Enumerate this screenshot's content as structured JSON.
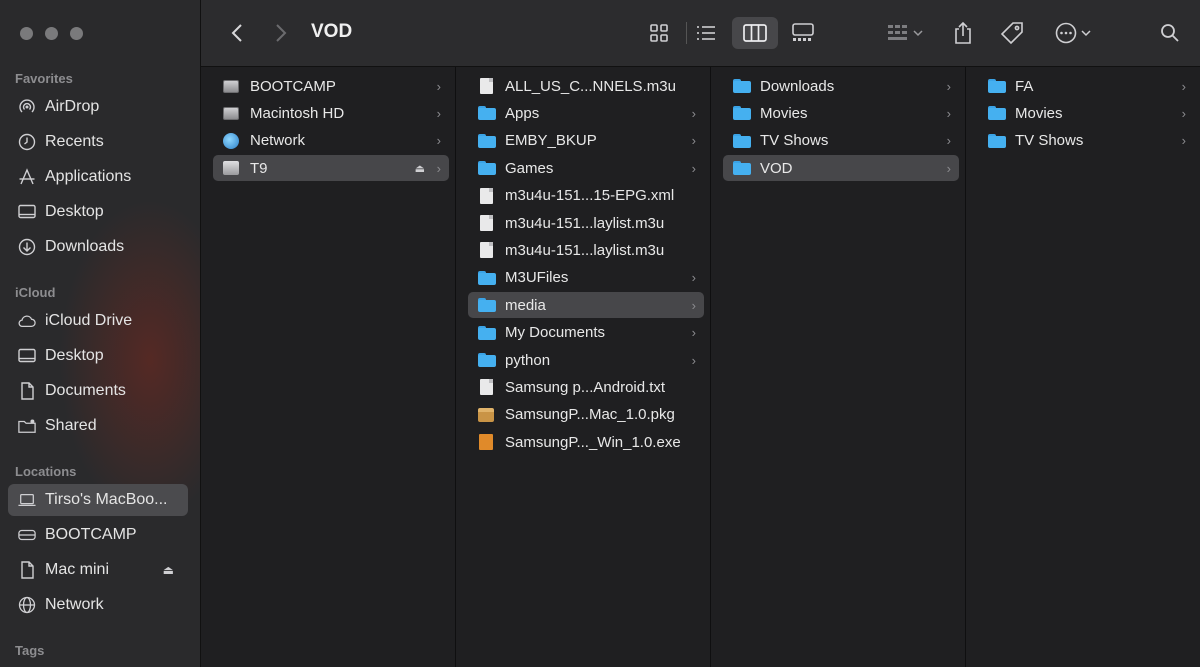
{
  "window": {
    "title": "VOD"
  },
  "sidebar": {
    "favorites_title": "Favorites",
    "favorites": [
      {
        "label": "AirDrop",
        "icon": "airdrop-icon"
      },
      {
        "label": "Recents",
        "icon": "clock-icon"
      },
      {
        "label": "Applications",
        "icon": "applications-icon"
      },
      {
        "label": "Desktop",
        "icon": "desktop-icon"
      },
      {
        "label": "Downloads",
        "icon": "download-icon"
      }
    ],
    "icloud_title": "iCloud",
    "icloud": [
      {
        "label": "iCloud Drive",
        "icon": "cloud-icon"
      },
      {
        "label": "Desktop",
        "icon": "desktop-icon"
      },
      {
        "label": "Documents",
        "icon": "document-icon"
      },
      {
        "label": "Shared",
        "icon": "shared-folder-icon"
      }
    ],
    "locations_title": "Locations",
    "locations": [
      {
        "label": "Tirso's MacBoo...",
        "icon": "laptop-icon",
        "selected": true
      },
      {
        "label": "BOOTCAMP",
        "icon": "drive-icon"
      },
      {
        "label": "Mac mini",
        "icon": "document-icon",
        "eject": "⏏"
      },
      {
        "label": "Network",
        "icon": "globe-icon"
      }
    ],
    "tags_title": "Tags"
  },
  "columns": [
    [
      {
        "name": "BOOTCAMP",
        "type": "disk",
        "chevron": true
      },
      {
        "name": "Macintosh HD",
        "type": "disk",
        "chevron": true
      },
      {
        "name": "Network",
        "type": "globe",
        "chevron": true
      },
      {
        "name": "T9",
        "type": "usb",
        "chevron": true,
        "selected": true,
        "eject": "⏏"
      }
    ],
    [
      {
        "name": "ALL_US_C...NNELS.m3u",
        "type": "doc",
        "chevron": false
      },
      {
        "name": "Apps",
        "type": "folder",
        "chevron": true
      },
      {
        "name": "EMBY_BKUP",
        "type": "folder",
        "chevron": true
      },
      {
        "name": "Games",
        "type": "folder",
        "chevron": true
      },
      {
        "name": "m3u4u-151...15-EPG.xml",
        "type": "doc",
        "chevron": false
      },
      {
        "name": "m3u4u-151...laylist.m3u",
        "type": "doc",
        "chevron": false
      },
      {
        "name": "m3u4u-151...laylist.m3u",
        "type": "doc",
        "chevron": false
      },
      {
        "name": "M3UFiles",
        "type": "folder",
        "chevron": true
      },
      {
        "name": "media",
        "type": "folder",
        "chevron": true,
        "selected": true
      },
      {
        "name": "My Documents",
        "type": "folder",
        "chevron": true
      },
      {
        "name": "python",
        "type": "folder",
        "chevron": true
      },
      {
        "name": "Samsung p...Android.txt",
        "type": "doc",
        "chevron": false
      },
      {
        "name": "SamsungP...Mac_1.0.pkg",
        "type": "pkg",
        "chevron": false
      },
      {
        "name": "SamsungP..._Win_1.0.exe",
        "type": "exe",
        "chevron": false
      }
    ],
    [
      {
        "name": "Downloads",
        "type": "folder",
        "chevron": true
      },
      {
        "name": "Movies",
        "type": "folder",
        "chevron": true
      },
      {
        "name": "TV Shows",
        "type": "folder",
        "chevron": true
      },
      {
        "name": "VOD",
        "type": "folder",
        "chevron": true,
        "selected": true
      }
    ],
    [
      {
        "name": "FA",
        "type": "folder",
        "chevron": true
      },
      {
        "name": "Movies",
        "type": "folder",
        "chevron": true
      },
      {
        "name": "TV Shows",
        "type": "folder",
        "chevron": true
      }
    ]
  ],
  "chevron_glyph": "›"
}
